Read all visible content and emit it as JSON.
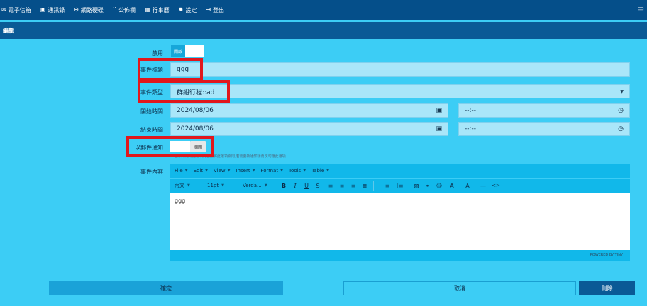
{
  "nav": {
    "items": [
      {
        "icon": "✉",
        "label": "電子信箱"
      },
      {
        "icon": "▣",
        "label": "通訊錄"
      },
      {
        "icon": "⊖",
        "label": "網路硬碟"
      },
      {
        "icon": "⁚⁚",
        "label": "公佈欄"
      },
      {
        "icon": "▦",
        "label": "行事曆"
      },
      {
        "icon": "✹",
        "label": "設定"
      },
      {
        "icon": "⇥",
        "label": "登出"
      }
    ],
    "monitor_icon": "▭"
  },
  "section": {
    "title": "編輯"
  },
  "form": {
    "enable_label": "啟用",
    "enable_toggle_on": "開啟",
    "title_label": "事件標題",
    "title_value": "ggg",
    "type_label": "事件類型",
    "type_value": "群組行程::ad",
    "start_label": "開始時間",
    "start_date": "2024/08/06",
    "start_time": "--:--",
    "end_label": "結束時間",
    "end_date": "2024/08/06",
    "end_time": "--:--",
    "notify_label": "以郵件通知",
    "notify_toggle_off": "關閉",
    "notify_hint": "若未勾選則此選項將自動將此選項關閉,若需要新通知請再次勾選此選項",
    "content_label": "事件內容"
  },
  "editor": {
    "menu": [
      "File",
      "Edit",
      "View",
      "Insert",
      "Format",
      "Tools",
      "Table"
    ],
    "block_format": "內文",
    "font_size": "11pt",
    "font_family": "Verda...",
    "content": "ggg",
    "powered_by": "POWERED BY TINY"
  },
  "buttons": {
    "confirm": "確定",
    "cancel": "取消",
    "delete": "刪除"
  },
  "colors": {
    "background": "#3ccdf5",
    "nav": "#054f8a",
    "highlight": "#e1171c"
  }
}
